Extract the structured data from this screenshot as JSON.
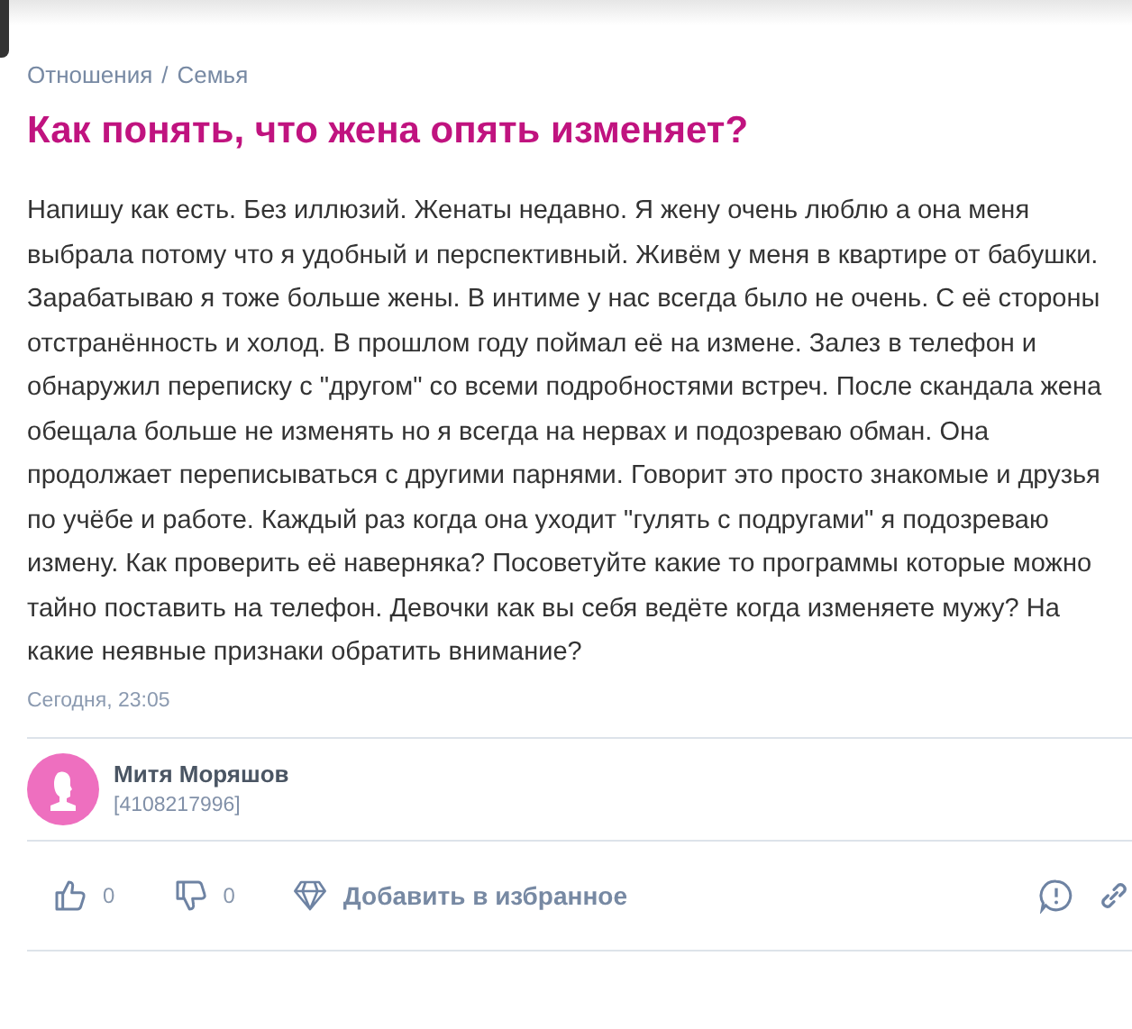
{
  "breadcrumbs": [
    "Отношения",
    "Семья"
  ],
  "breadcrumb_separator": "/",
  "title": "Как понять, что жена опять изменяет?",
  "body": "Напишу как есть. Без иллюзий. Женаты недавно. Я жену очень люблю а она меня выбрала потому что я удобный и перспективный. Живём у меня в квартире от бабушки. Зарабатываю я тоже больше жены. В интиме у нас всегда было не очень. С её стороны отстранённость и холод. В прошлом году поймал её на измене. Залез в телефон и обнаружил переписку с \"другом\" со всеми подробностями встреч. После скандала жена обещала больше не изменять но я всегда на нервах и подозреваю обман. Она продолжает переписываться с другими парнями. Говорит это просто знакомые и друзья по учёбе и работе. Каждый раз когда она уходит \"гулять с подругами\" я подозреваю измену. Как проверить её наверняка? Посоветуйте какие то программы которые можно тайно поставить на телефон. Девочки как вы себя ведёте когда изменяете мужу? На какие неявные признаки обратить внимание?",
  "timestamp": "Сегодня, 23:05",
  "author": {
    "name": "Митя Моряшов",
    "id": "[4108217996]",
    "color": "#ee6fbf"
  },
  "actions": {
    "likes": "0",
    "dislikes": "0",
    "favorite": "Добавить в избранное"
  }
}
